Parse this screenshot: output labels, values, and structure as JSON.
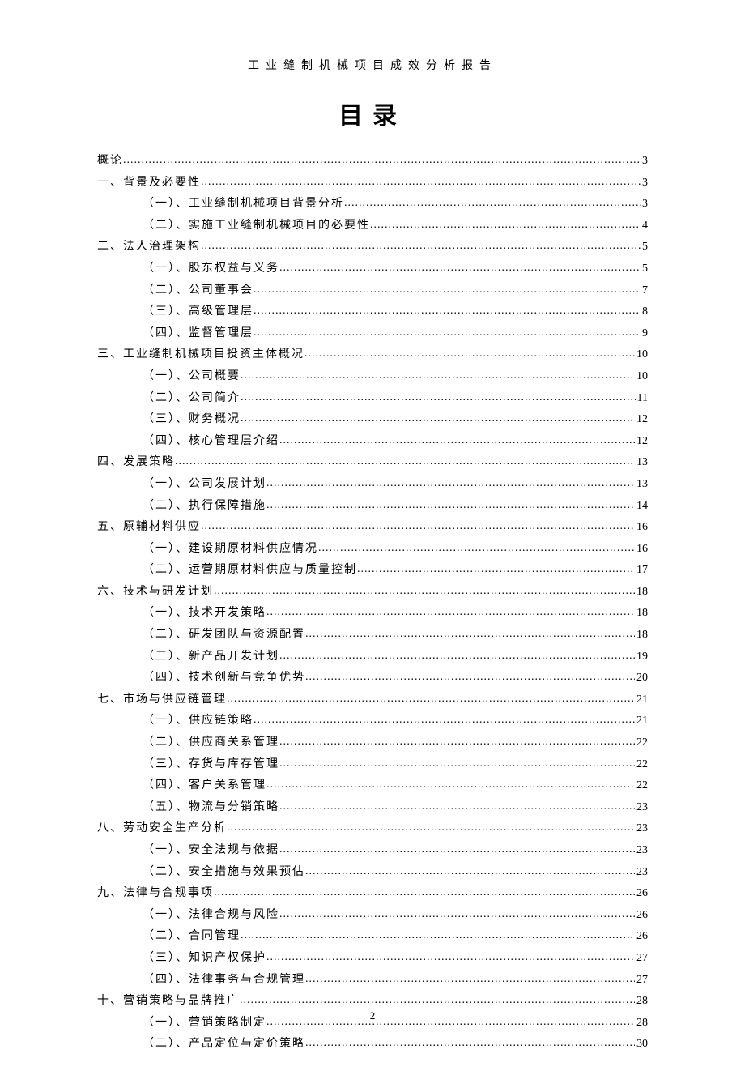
{
  "header": "工业缝制机械项目成效分析报告",
  "title": "目录",
  "pageNumber": "2",
  "toc": [
    {
      "level": 0,
      "label": "概论",
      "page": "3"
    },
    {
      "level": 0,
      "label": "一、背景及必要性",
      "page": "3"
    },
    {
      "level": 1,
      "label": "（一）、工业缝制机械项目背景分析",
      "page": "3"
    },
    {
      "level": 1,
      "label": "（二）、实施工业缝制机械项目的必要性",
      "page": "4"
    },
    {
      "level": 0,
      "label": "二、法人治理架构",
      "page": "5"
    },
    {
      "level": 1,
      "label": "（一）、股东权益与义务",
      "page": "5"
    },
    {
      "level": 1,
      "label": "（二）、公司董事会",
      "page": "7"
    },
    {
      "level": 1,
      "label": "（三）、高级管理层",
      "page": "8"
    },
    {
      "level": 1,
      "label": "（四）、监督管理层",
      "page": "9"
    },
    {
      "level": 0,
      "label": "三、工业缝制机械项目投资主体概况",
      "page": "10"
    },
    {
      "level": 1,
      "label": "（一）、公司概要",
      "page": "10"
    },
    {
      "level": 1,
      "label": "（二）、公司简介",
      "page": "11"
    },
    {
      "level": 1,
      "label": "（三）、财务概况",
      "page": "12"
    },
    {
      "level": 1,
      "label": "（四）、核心管理层介绍",
      "page": "12"
    },
    {
      "level": 0,
      "label": "四、发展策略",
      "page": "13"
    },
    {
      "level": 1,
      "label": "（一）、公司发展计划",
      "page": "13"
    },
    {
      "level": 1,
      "label": "（二）、执行保障措施",
      "page": "14"
    },
    {
      "level": 0,
      "label": "五、原辅材料供应",
      "page": "16"
    },
    {
      "level": 1,
      "label": "（一）、建设期原材料供应情况",
      "page": "16"
    },
    {
      "level": 1,
      "label": "（二）、运营期原材料供应与质量控制",
      "page": "17"
    },
    {
      "level": 0,
      "label": "六、技术与研发计划",
      "page": "18"
    },
    {
      "level": 1,
      "label": "（一）、技术开发策略",
      "page": "18"
    },
    {
      "level": 1,
      "label": "（二）、研发团队与资源配置",
      "page": "18"
    },
    {
      "level": 1,
      "label": "（三）、新产品开发计划",
      "page": "19"
    },
    {
      "level": 1,
      "label": "（四）、技术创新与竞争优势",
      "page": "20"
    },
    {
      "level": 0,
      "label": "七、市场与供应链管理",
      "page": "21"
    },
    {
      "level": 1,
      "label": "（一）、供应链策略",
      "page": "21"
    },
    {
      "level": 1,
      "label": "（二）、供应商关系管理",
      "page": "22"
    },
    {
      "level": 1,
      "label": "（三）、存货与库存管理",
      "page": "22"
    },
    {
      "level": 1,
      "label": "（四）、客户关系管理",
      "page": "22"
    },
    {
      "level": 1,
      "label": "（五）、物流与分销策略",
      "page": "23"
    },
    {
      "level": 0,
      "label": "八、劳动安全生产分析",
      "page": "23"
    },
    {
      "level": 1,
      "label": "（一）、安全法规与依据",
      "page": "23"
    },
    {
      "level": 1,
      "label": "（二）、安全措施与效果预估",
      "page": "23"
    },
    {
      "level": 0,
      "label": "九、法律与合规事项",
      "page": "26"
    },
    {
      "level": 1,
      "label": "（一）、法律合规与风险",
      "page": "26"
    },
    {
      "level": 1,
      "label": "（二）、合同管理",
      "page": "26"
    },
    {
      "level": 1,
      "label": "（三）、知识产权保护",
      "page": "27"
    },
    {
      "level": 1,
      "label": "（四）、法律事务与合规管理",
      "page": "27"
    },
    {
      "level": 0,
      "label": "十、营销策略与品牌推广",
      "page": "28"
    },
    {
      "level": 1,
      "label": "（一）、营销策略制定",
      "page": "28"
    },
    {
      "level": 1,
      "label": "（二）、产品定位与定价策略",
      "page": "30"
    }
  ]
}
